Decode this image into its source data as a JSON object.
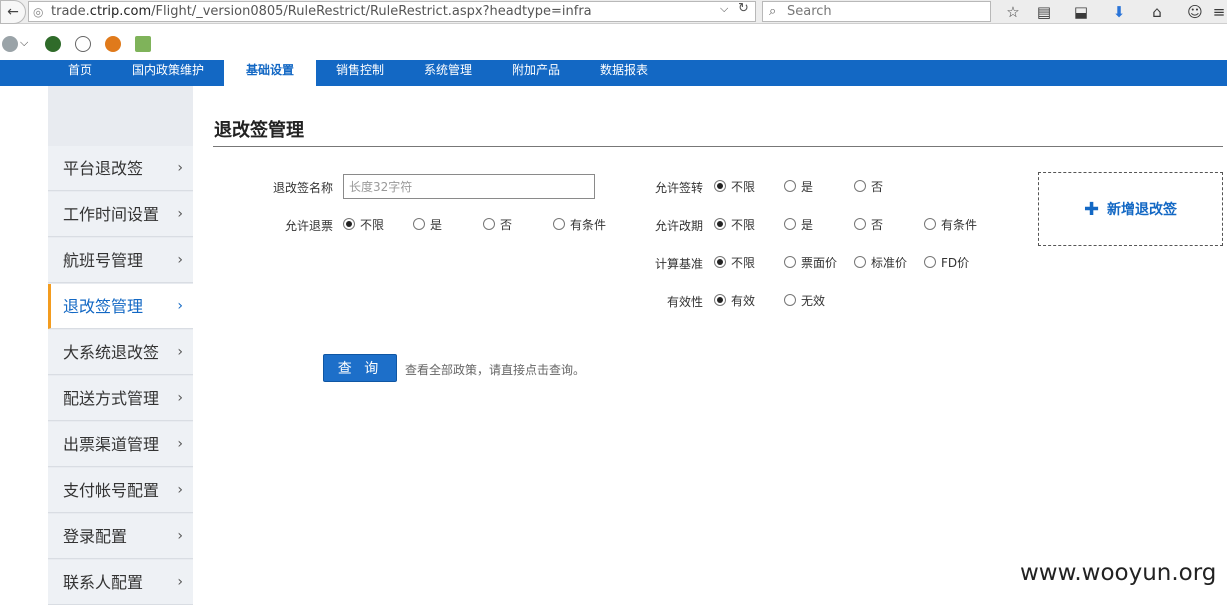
{
  "browser": {
    "url_prefix": "trade.",
    "url_host": "ctrip.com",
    "url_path": "/Flight/_version0805/RuleRestrict/RuleRestrict.aspx?headtype=infra",
    "search_placeholder": "Search"
  },
  "nav": {
    "tabs": [
      {
        "label": "首页"
      },
      {
        "label": "国内政策维护"
      },
      {
        "label": "基础设置"
      },
      {
        "label": "销售控制"
      },
      {
        "label": "系统管理"
      },
      {
        "label": "附加产品"
      },
      {
        "label": "数据报表"
      }
    ],
    "active_index": 2
  },
  "sidebar": {
    "items": [
      {
        "label": "平台退改签"
      },
      {
        "label": "工作时间设置"
      },
      {
        "label": "航班号管理"
      },
      {
        "label": "退改签管理"
      },
      {
        "label": "大系统退改签"
      },
      {
        "label": "配送方式管理"
      },
      {
        "label": "出票渠道管理"
      },
      {
        "label": "支付帐号配置"
      },
      {
        "label": "登录配置"
      },
      {
        "label": "联系人配置"
      }
    ],
    "active_index": 3
  },
  "main": {
    "title": "退改签管理",
    "form": {
      "name_label": "退改签名称",
      "name_placeholder": "长度32字符",
      "refund_label": "允许退票",
      "refund_options": [
        "不限",
        "是",
        "否",
        "有条件"
      ],
      "endorse_label": "允许签转",
      "endorse_options": [
        "不限",
        "是",
        "否"
      ],
      "change_label": "允许改期",
      "change_options": [
        "不限",
        "是",
        "否",
        "有条件"
      ],
      "basis_label": "计算基准",
      "basis_options": [
        "不限",
        "票面价",
        "标准价",
        "FD价"
      ],
      "valid_label": "有效性",
      "valid_options": [
        "有效",
        "无效"
      ]
    },
    "add_label": "新增退改签",
    "query_label": "查 询",
    "query_hint": "查看全部政策，请直接点击查询。"
  },
  "watermark": "www.wooyun.org",
  "colors": {
    "nav_blue": "#1368c4",
    "active_accent": "#f39c1f"
  }
}
